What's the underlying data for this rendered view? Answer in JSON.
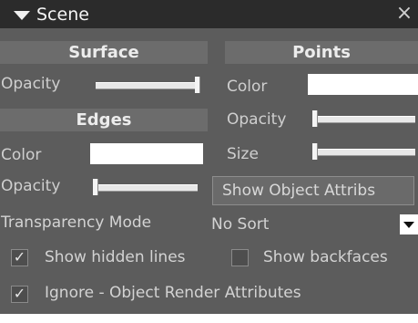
{
  "panel": {
    "title": "Scene",
    "close_glyph": "×"
  },
  "surface": {
    "header": "Surface",
    "opacity_label": "Opacity",
    "opacity_value": 1.0
  },
  "edges": {
    "header": "Edges",
    "color_label": "Color",
    "color_value": "#ffffff",
    "opacity_label": "Opacity",
    "opacity_value": 0.0
  },
  "points": {
    "header": "Points",
    "color_label": "Color",
    "color_value": "#ffffff",
    "opacity_label": "Opacity",
    "opacity_value": 0.0,
    "size_label": "Size",
    "size_value": 0.0,
    "show_object_attribs_label": "Show Object Attribs"
  },
  "transparency": {
    "label": "Transparency Mode",
    "selected": "No Sort"
  },
  "options": {
    "check_glyph": "✓",
    "show_hidden_lines": {
      "label": "Show hidden lines",
      "checked": true
    },
    "show_backfaces": {
      "label": "Show backfaces",
      "checked": false
    },
    "ignore_render_attributes": {
      "label": "Ignore - Object Render Attributes",
      "checked": true
    }
  },
  "icons": {
    "collapse": "triangle-down-icon",
    "close": "close-icon",
    "dropdown": "chevron-down-icon",
    "checkmark": "checkmark-icon"
  },
  "colors": {
    "panel_background": "#5c5c5c",
    "title_bar": "#2b2b2b",
    "section_header": "#6c6c6c",
    "label_text": "#cfcfcf"
  }
}
